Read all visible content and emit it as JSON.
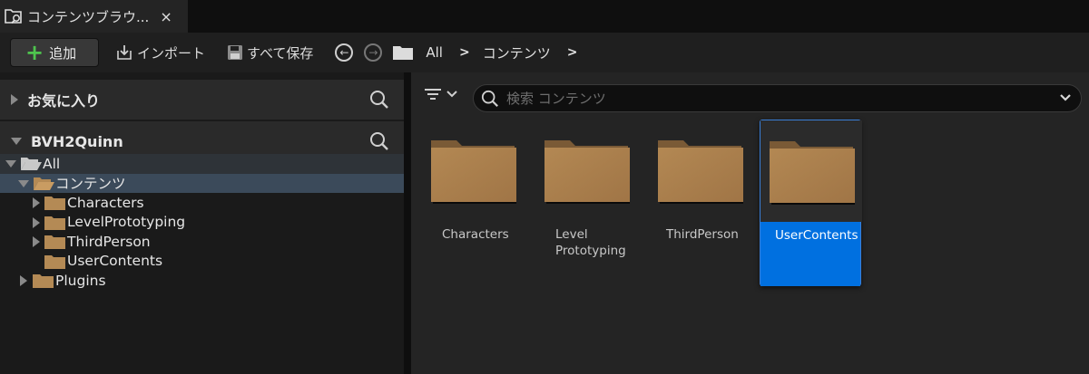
{
  "tab": {
    "title": "コンテンツブラウ...",
    "close": "×",
    "icon": "content-browser-icon"
  },
  "toolbar": {
    "add_label": "追加",
    "import_label": "インポート",
    "saveall_label": "すべて保存",
    "breadcrumb": [
      "All",
      "コンテンツ"
    ]
  },
  "left": {
    "favorites_title": "お気に入り",
    "project_title": "BVH2Quinn",
    "tree": [
      {
        "label": "All",
        "level": 0,
        "expanded": true
      },
      {
        "label": "コンテンツ",
        "level": 1,
        "expanded": true,
        "selected": true
      },
      {
        "label": "Characters",
        "level": 2,
        "expanded": false,
        "has_children": true
      },
      {
        "label": "LevelPrototyping",
        "level": 2,
        "expanded": false,
        "has_children": true
      },
      {
        "label": "ThirdPerson",
        "level": 2,
        "expanded": false,
        "has_children": true
      },
      {
        "label": "UserContents",
        "level": 2,
        "has_children": false
      },
      {
        "label": "Plugins",
        "level": 1,
        "expanded": false,
        "has_children": true
      }
    ]
  },
  "search": {
    "placeholder": "検索 コンテンツ"
  },
  "tiles": [
    {
      "label": "Characters",
      "selected": false
    },
    {
      "label": "Level Prototyping",
      "selected": false
    },
    {
      "label": "ThirdPerson",
      "selected": false
    },
    {
      "label": "UserContents",
      "selected": true
    }
  ],
  "colors": {
    "accent": "#0070e0",
    "folder": "#b48a55",
    "add_plus": "#4ec44e"
  }
}
